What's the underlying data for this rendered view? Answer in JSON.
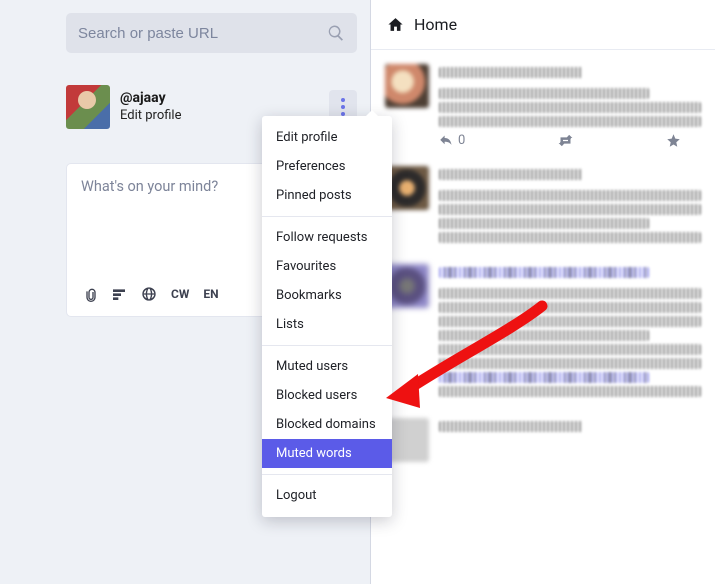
{
  "search": {
    "placeholder": "Search or paste URL"
  },
  "profile": {
    "username": "@ajaay",
    "edit_label": "Edit profile"
  },
  "compose": {
    "placeholder": "What's on your mind?",
    "cw_label": "CW",
    "lang_label": "EN"
  },
  "column_header": {
    "title": "Home"
  },
  "feed_actions": {
    "reply_count": "0"
  },
  "menu": {
    "group1": [
      "Edit profile",
      "Preferences",
      "Pinned posts"
    ],
    "group2": [
      "Follow requests",
      "Favourites",
      "Bookmarks",
      "Lists"
    ],
    "group3": [
      "Muted users",
      "Blocked users",
      "Blocked domains",
      "Muted words"
    ],
    "group4": [
      "Logout"
    ],
    "active_index": 10
  }
}
